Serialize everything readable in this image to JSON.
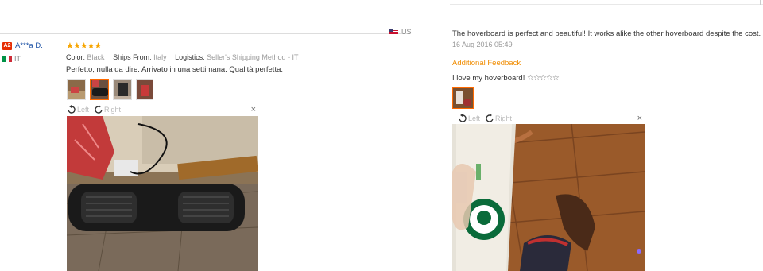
{
  "left_review": {
    "buyer_badge": "A2",
    "buyer_name": "A***a D.",
    "country": "IT",
    "rating_stars": "★★★★★",
    "rating": 5,
    "meta": {
      "color_key": "Color:",
      "color_val": "Black",
      "ships_key": "Ships From:",
      "ships_val": "Italy",
      "logistics_key": "Logistics:",
      "logistics_val": "Seller's Shipping Method - IT"
    },
    "text": "Perfetto, nulla da dire. Arrivato in una settimana. Qualità perfetta.",
    "thumbnail_count": 4,
    "viewer": {
      "left_label": "Left",
      "right_label": "Right",
      "close": "×"
    }
  },
  "right_review": {
    "country": "US",
    "text": "The hoverboard is perfect and beautiful! It works alike the other hoverboard despite the cost. I love",
    "date": "16 Aug 2016 05:49",
    "additional_feedback_title": "Additional Feedback",
    "additional_feedback_text": "I love my hoverboard!",
    "additional_feedback_stars": "☆☆☆☆☆",
    "thumbnail_count": 1,
    "viewer": {
      "left_label": "Left",
      "right_label": "Right",
      "close": "×"
    }
  },
  "colors": {
    "accent_orange": "#f08c00",
    "star_color": "#f7a500",
    "badge_red": "#e62e04",
    "name_blue": "#1d52a6"
  }
}
